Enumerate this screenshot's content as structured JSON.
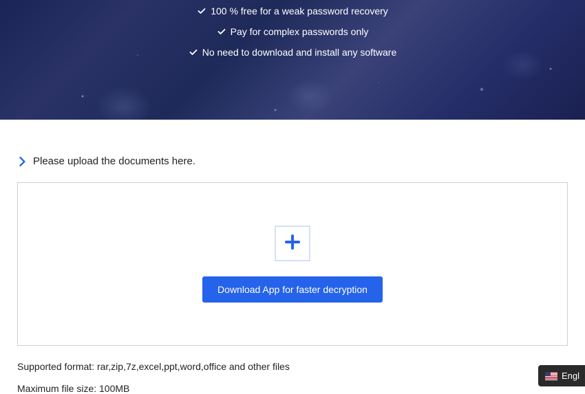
{
  "hero": {
    "features": [
      "100 % free for a weak password recovery",
      "Pay for complex passwords only",
      "No need to download and install any software"
    ]
  },
  "upload": {
    "prompt": "Please upload the documents here.",
    "download_btn": "Download App for faster decryption"
  },
  "info": {
    "supported": "Supported format: rar,zip,7z,excel,ppt,word,office and other files",
    "maxsize": "Maximum file size: 100MB"
  },
  "lang": {
    "label": "Engl"
  }
}
